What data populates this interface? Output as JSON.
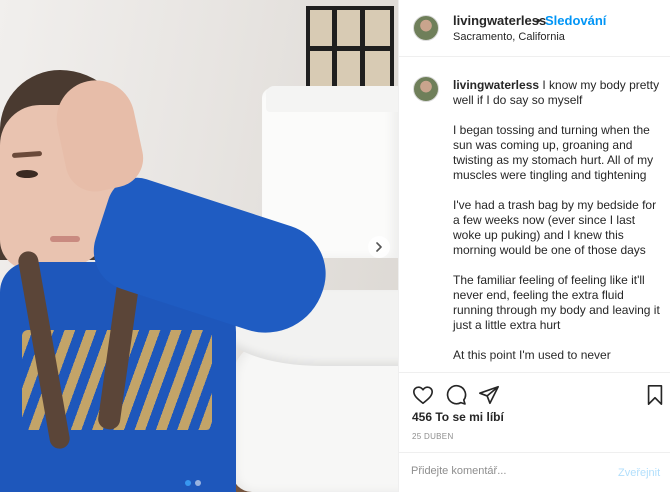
{
  "header": {
    "username": "livingwaterless",
    "separator": "•",
    "follow_label": "Sledování",
    "location": "Sacramento, California"
  },
  "caption": {
    "username": "livingwaterless",
    "paragraphs": [
      "I know my body pretty well if I do say so myself",
      "I began tossing and turning when the sun was coming up, groaning and twisting as my stomach hurt. All of my muscles were tingling and tightening",
      "I've had a trash bag by my bedside for a few weeks now (ever since I last woke up puking) and I knew this morning would be one of those days",
      "The familiar feeling of feeling like it'll never end, feeling the extra fluid running through my body and leaving it just a little extra hurt",
      "At this point I'm used to never"
    ]
  },
  "actions": {
    "like_icon": "heart-icon",
    "comment_icon": "comment-icon",
    "share_icon": "share-icon",
    "save_icon": "bookmark-icon"
  },
  "likes": "456 To se mi líbí",
  "date": "25 DUBEN",
  "comment": {
    "placeholder": "Přidejte komentář...",
    "post_label": "Zveřejnit"
  },
  "carousel": {
    "count": 2,
    "active_index": 0
  },
  "colors": {
    "follow": "#0095f6",
    "post_disabled": "#b2dffc",
    "text": "#262626",
    "muted": "#8e8e8e",
    "border": "#efefef"
  }
}
